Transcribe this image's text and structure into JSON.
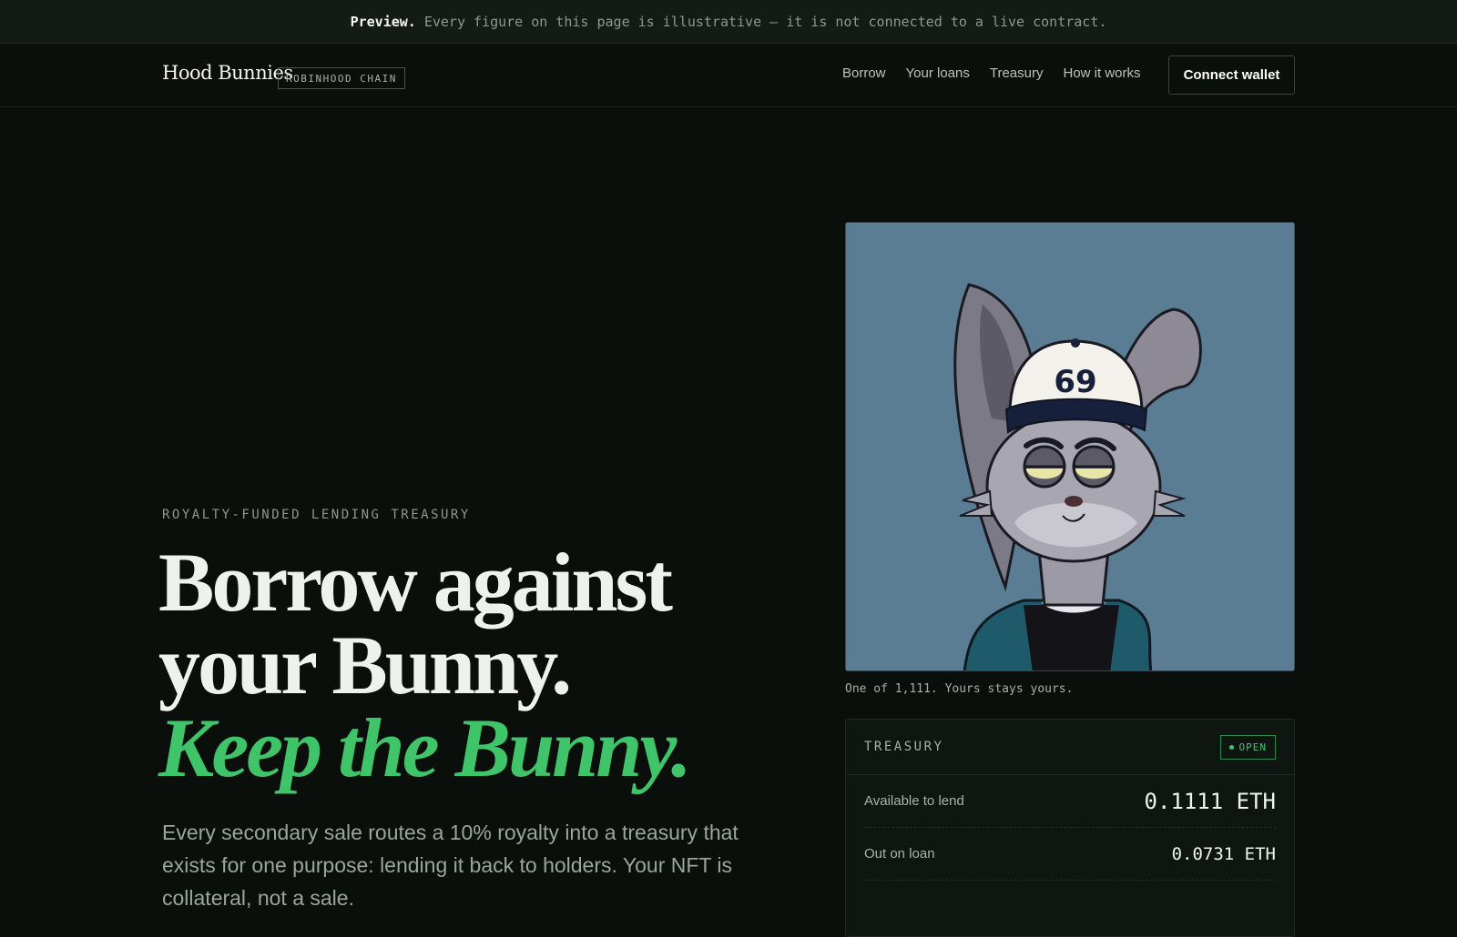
{
  "banner": {
    "bold": "Preview.",
    "text": "Every figure on this page is illustrative — it is not connected to a live contract."
  },
  "nav": {
    "brand": "Hood Bunnies",
    "chain_badge": "ROBINHOOD CHAIN",
    "links": [
      "Borrow",
      "Your loans",
      "Treasury",
      "How it works"
    ],
    "connect_label": "Connect wallet"
  },
  "hero": {
    "eyebrow": "ROYALTY-FUNDED LENDING TREASURY",
    "headline_line1": "Borrow against",
    "headline_line2": "your Bunny.",
    "headline_accent": "Keep the Bunny.",
    "lead": "Every secondary sale routes a 10% royalty into a treasury that exists for one purpose: lending it back to holders. Your NFT is collateral, not a sale."
  },
  "art": {
    "cap_number": "69",
    "caption": "One of 1,111. Yours stays yours."
  },
  "treasury": {
    "title": "TREASURY",
    "status": "OPEN",
    "rows": [
      {
        "label": "Available to lend",
        "value": "0.1111 ETH"
      },
      {
        "label": "Out on loan",
        "value": "0.0731 ETH"
      }
    ]
  },
  "colors": {
    "accent": "#3fc46a",
    "background": "#0a0f0c",
    "art_background": "#5a7d94"
  }
}
